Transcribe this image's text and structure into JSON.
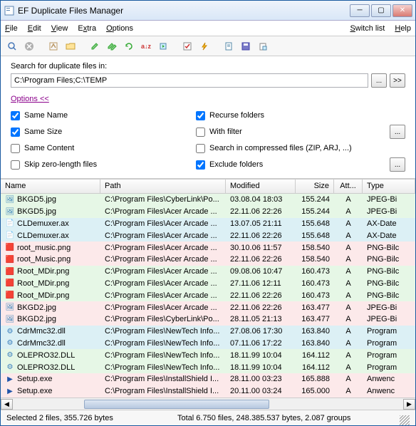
{
  "window": {
    "title": "EF Duplicate Files Manager"
  },
  "menu": {
    "file": "File",
    "edit": "Edit",
    "view": "View",
    "extra": "Extra",
    "options": "Options",
    "switch": "Switch list",
    "help": "Help"
  },
  "search": {
    "label": "Search for duplicate files in:",
    "path": "C:\\Program Files;C:\\TEMP",
    "browse": "...",
    "expand": ">>",
    "options_link": "Options  <<",
    "same_name": "Same Name",
    "same_size": "Same Size",
    "same_content": "Same Content",
    "skip_zero": "Skip zero-length files",
    "recurse": "Recurse folders",
    "with_filter": "With filter",
    "compressed": "Search in compressed files (ZIP, ARJ, ...)",
    "exclude": "Exclude folders",
    "checked": {
      "same_name": true,
      "same_size": true,
      "same_content": false,
      "skip_zero": false,
      "recurse": true,
      "with_filter": false,
      "compressed": false,
      "exclude": true
    }
  },
  "columns": {
    "name": "Name",
    "path": "Path",
    "modified": "Modified",
    "size": "Size",
    "att": "Att...",
    "type": "Type"
  },
  "icons": {
    "jpeg": "🖼",
    "ax": "📄",
    "png": "🟥",
    "dll": "⚙",
    "exe": "▶"
  },
  "colors": {
    "jpeg": "#2a7ab5",
    "ax": "#666",
    "png": "#b33",
    "dll": "#3a7fbd",
    "exe": "#2255aa"
  },
  "rows": [
    {
      "name": "BKGD5.jpg",
      "path": "C:\\Program Files\\CyberLink\\Po...",
      "mod": "03.08.04  18:03",
      "size": "155.244",
      "att": "A",
      "type": "JPEG-Bi",
      "icon": "jpeg",
      "bg": 0
    },
    {
      "name": "BKGD5.jpg",
      "path": "C:\\Program Files\\Acer Arcade ...",
      "mod": "22.11.06  22:26",
      "size": "155.244",
      "att": "A",
      "type": "JPEG-Bi",
      "icon": "jpeg",
      "bg": 0
    },
    {
      "name": "CLDemuxer.ax",
      "path": "C:\\Program Files\\Acer Arcade ...",
      "mod": "13.07.05  21:11",
      "size": "155.648",
      "att": "A",
      "type": "AX-Date",
      "icon": "ax",
      "bg": 2
    },
    {
      "name": "CLDemuxer.ax",
      "path": "C:\\Program Files\\Acer Arcade ...",
      "mod": "22.11.06  22:26",
      "size": "155.648",
      "att": "A",
      "type": "AX-Date",
      "icon": "ax",
      "bg": 2
    },
    {
      "name": "root_music.png",
      "path": "C:\\Program Files\\Acer Arcade ...",
      "mod": "30.10.06  11:57",
      "size": "158.540",
      "att": "A",
      "type": "PNG-Bilc",
      "icon": "png",
      "bg": 1
    },
    {
      "name": "root_Music.png",
      "path": "C:\\Program Files\\Acer Arcade ...",
      "mod": "22.11.06  22:26",
      "size": "158.540",
      "att": "A",
      "type": "PNG-Bilc",
      "icon": "png",
      "bg": 1
    },
    {
      "name": "Root_MDir.png",
      "path": "C:\\Program Files\\Acer Arcade ...",
      "mod": "09.08.06  10:47",
      "size": "160.473",
      "att": "A",
      "type": "PNG-Bilc",
      "icon": "png",
      "bg": 0
    },
    {
      "name": "Root_MDir.png",
      "path": "C:\\Program Files\\Acer Arcade ...",
      "mod": "27.11.06  12:11",
      "size": "160.473",
      "att": "A",
      "type": "PNG-Bilc",
      "icon": "png",
      "bg": 0
    },
    {
      "name": "Root_MDir.png",
      "path": "C:\\Program Files\\Acer Arcade ...",
      "mod": "22.11.06  22:26",
      "size": "160.473",
      "att": "A",
      "type": "PNG-Bilc",
      "icon": "png",
      "bg": 0
    },
    {
      "name": "BKGD2.jpg",
      "path": "C:\\Program Files\\Acer Arcade ...",
      "mod": "22.11.06  22:26",
      "size": "163.477",
      "att": "A",
      "type": "JPEG-Bi",
      "icon": "jpeg",
      "bg": 1
    },
    {
      "name": "BKGD2.jpg",
      "path": "C:\\Program Files\\CyberLink\\Po...",
      "mod": "28.11.05  21:13",
      "size": "163.477",
      "att": "A",
      "type": "JPEG-Bi",
      "icon": "jpeg",
      "bg": 1
    },
    {
      "name": "CdrMmc32.dll",
      "path": "C:\\Program Files\\NewTech Info...",
      "mod": "27.08.06  17:30",
      "size": "163.840",
      "att": "A",
      "type": "Program",
      "icon": "dll",
      "bg": 2
    },
    {
      "name": "CdrMmc32.dll",
      "path": "C:\\Program Files\\NewTech Info...",
      "mod": "07.11.06  17:22",
      "size": "163.840",
      "att": "A",
      "type": "Program",
      "icon": "dll",
      "bg": 2
    },
    {
      "name": "OLEPRO32.DLL",
      "path": "C:\\Program Files\\NewTech Info...",
      "mod": "18.11.99  10:04",
      "size": "164.112",
      "att": "A",
      "type": "Program",
      "icon": "dll",
      "bg": 0
    },
    {
      "name": "OLEPRO32.DLL",
      "path": "C:\\Program Files\\NewTech Info...",
      "mod": "18.11.99  10:04",
      "size": "164.112",
      "att": "A",
      "type": "Program",
      "icon": "dll",
      "bg": 0
    },
    {
      "name": "Setup.exe",
      "path": "C:\\Program Files\\InstallShield I...",
      "mod": "28.11.00  03:23",
      "size": "165.888",
      "att": "A",
      "type": "Anwenc",
      "icon": "exe",
      "bg": 1
    },
    {
      "name": "Setup.exe",
      "path": "C:\\Program Files\\InstallShield I...",
      "mod": "20.11.00  03:24",
      "size": "165.000",
      "att": "A",
      "type": "Anwenc",
      "icon": "exe",
      "bg": 1
    }
  ],
  "status": {
    "left": "Selected 2 files, 355.726 bytes",
    "right": "Total 6.750 files, 248.385.537 bytes, 2.087 groups"
  }
}
